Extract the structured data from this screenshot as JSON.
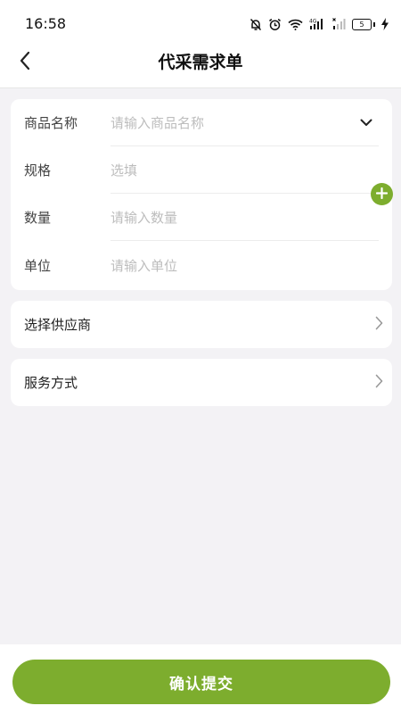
{
  "status_bar": {
    "time": "16:58",
    "battery_level": "5",
    "network_label": "4G",
    "icons": [
      "bell-off-icon",
      "alarm-icon",
      "wifi-icon",
      "signal-4g-icon",
      "signal-no-sim-icon",
      "battery-icon",
      "charging-icon"
    ]
  },
  "nav": {
    "title": "代采需求单",
    "back_icon": "chevron-left-icon"
  },
  "form": {
    "rows": [
      {
        "label": "商品名称",
        "value": "",
        "placeholder": "请输入商品名称",
        "icon": "chevron-down-icon"
      },
      {
        "label": "规格",
        "value": "",
        "placeholder": "选填"
      },
      {
        "label": "数量",
        "value": "",
        "placeholder": "请输入数量"
      },
      {
        "label": "单位",
        "value": "",
        "placeholder": "请输入单位"
      }
    ],
    "add_icon": "plus-circle-icon"
  },
  "selectors": [
    {
      "label": "选择供应商",
      "icon": "chevron-right-icon"
    },
    {
      "label": "服务方式",
      "icon": "chevron-right-icon"
    }
  ],
  "submit": {
    "label": "确认提交"
  },
  "colors": {
    "accent": "#7dad2e",
    "background": "#f3f2f5",
    "card": "#ffffff",
    "placeholder": "#bdbdbd"
  }
}
